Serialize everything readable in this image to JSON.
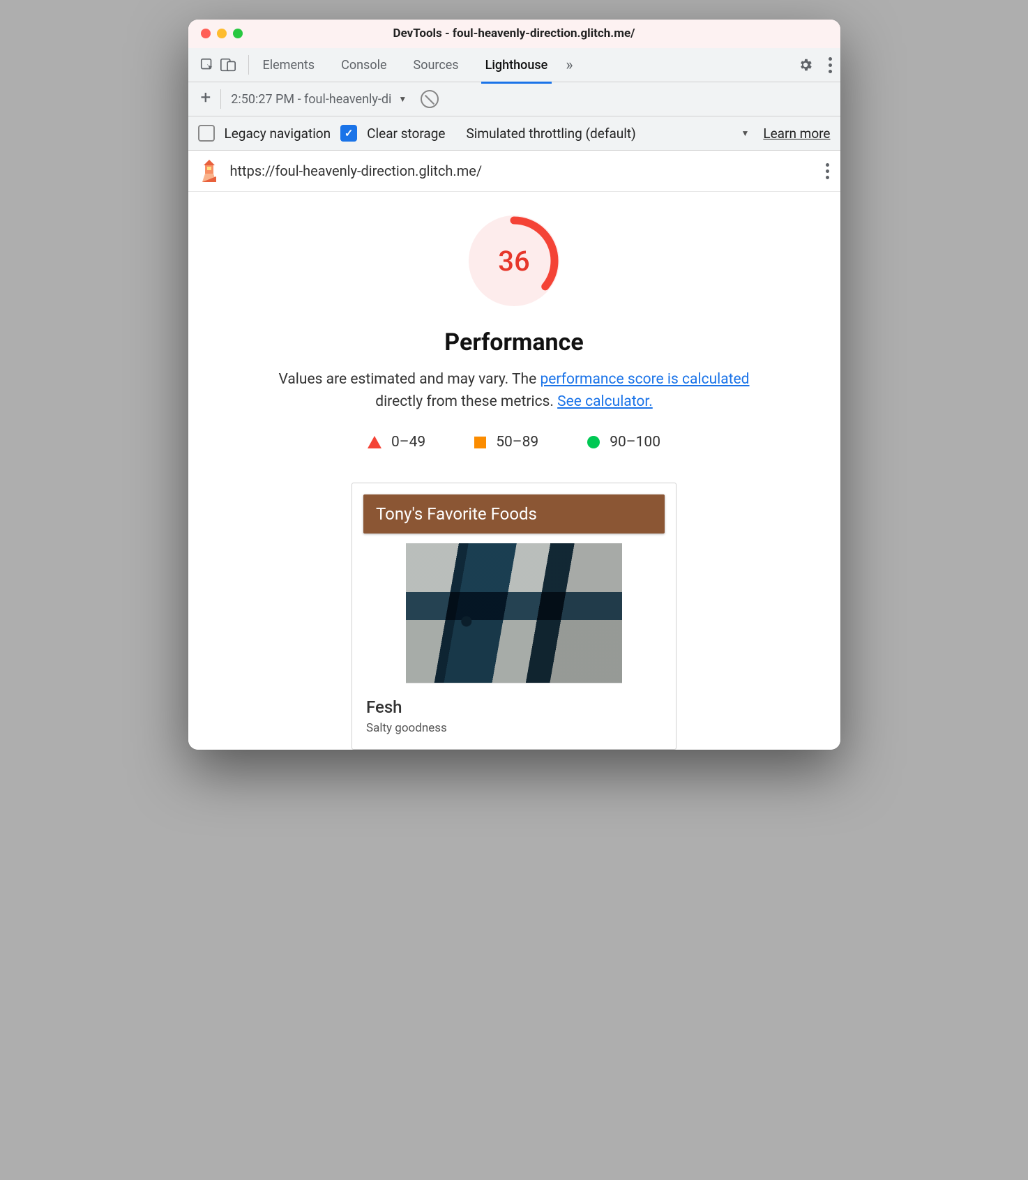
{
  "window": {
    "title": "DevTools - foul-heavenly-direction.glitch.me/"
  },
  "tabs": {
    "items": [
      "Elements",
      "Console",
      "Sources",
      "Lighthouse"
    ],
    "active_index": 3
  },
  "report_toolbar": {
    "selected_report": "2:50:27 PM - foul-heavenly-di"
  },
  "options": {
    "legacy_navigation": {
      "label": "Legacy navigation",
      "checked": false
    },
    "clear_storage": {
      "label": "Clear storage",
      "checked": true
    },
    "throttling": {
      "label": "Simulated throttling (default)"
    },
    "learn_more": "Learn more"
  },
  "report": {
    "url": "https://foul-heavenly-direction.glitch.me/",
    "score": "36",
    "category": "Performance",
    "desc_pre": "Values are estimated and may vary. The ",
    "desc_link1": "performance score is calculated",
    "desc_mid": " directly from these metrics. ",
    "desc_link2": "See calculator.",
    "legend": {
      "fail": "0–49",
      "avg": "50–89",
      "pass": "90–100"
    }
  },
  "snapshot": {
    "heading": "Tony's Favorite Foods",
    "item_title": "Fesh",
    "item_sub": "Salty goodness"
  }
}
